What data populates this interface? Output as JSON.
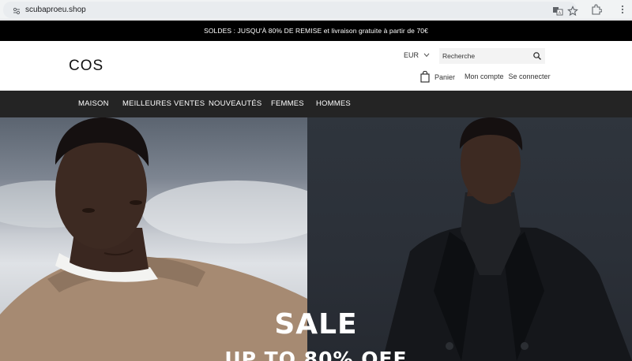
{
  "browser": {
    "url": "scubaproeu.shop",
    "icons": [
      "site-info-icon",
      "translate-icon",
      "star-icon",
      "extensions-icon",
      "menu-icon"
    ]
  },
  "promo": {
    "text": "SOLDES : JUSQU'À 80% DE REMISE et livraison gratuite à partir de 70€"
  },
  "header": {
    "logo": "COS",
    "currency": "EUR",
    "search_placeholder": "Recherche",
    "cart_label": "Panier",
    "account_label": "Mon compte",
    "login_label": "Se connecter"
  },
  "nav": {
    "items": [
      {
        "label": "MAISON"
      },
      {
        "label": "MEILLEURES VENTES"
      },
      {
        "label": "NOUVEAUTÉS"
      },
      {
        "label": "FEMMES"
      },
      {
        "label": "HOMMES"
      }
    ]
  },
  "hero": {
    "title": "SALE",
    "subtitle": "UP TO 80% OFF"
  },
  "colors": {
    "promo_bg": "#000000",
    "nav_bg": "#242424",
    "accent_text": "#ffffff"
  }
}
